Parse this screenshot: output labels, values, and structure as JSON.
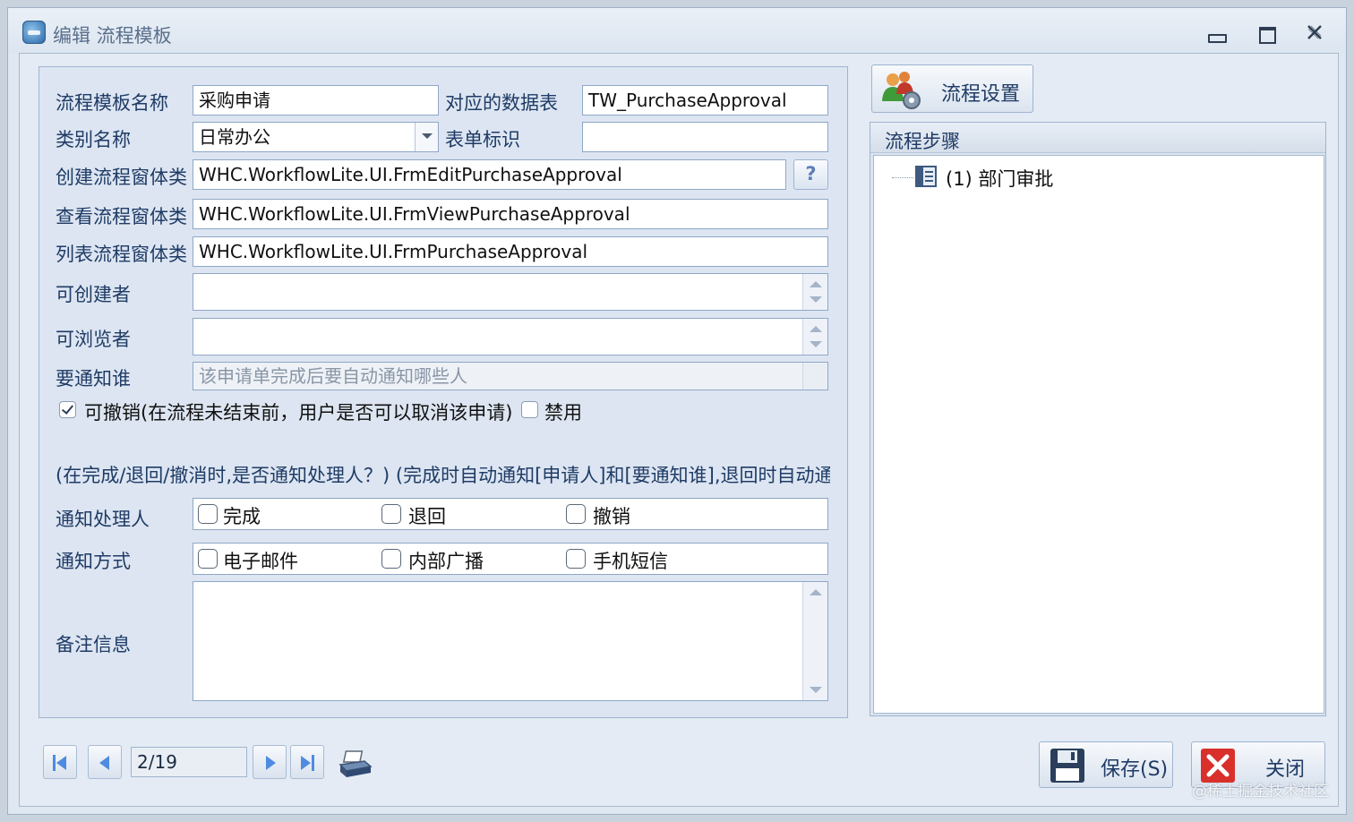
{
  "window": {
    "title": "编辑 流程模板"
  },
  "form": {
    "template_name": {
      "label": "流程模板名称",
      "value": "采购申请"
    },
    "table": {
      "label": "对应的数据表",
      "value": "TW_PurchaseApproval"
    },
    "category": {
      "label": "类别名称",
      "value": "日常办公"
    },
    "form_flag": {
      "label": "表单标识",
      "value": ""
    },
    "create_form": {
      "label": "创建流程窗体类",
      "value": "WHC.WorkflowLite.UI.FrmEditPurchaseApproval"
    },
    "help_symbol": "?",
    "view_form": {
      "label": "查看流程窗体类",
      "value": "WHC.WorkflowLite.UI.FrmViewPurchaseApproval"
    },
    "list_form": {
      "label": "列表流程窗体类",
      "value": "WHC.WorkflowLite.UI.FrmPurchaseApproval"
    },
    "creators": {
      "label": "可创建者",
      "value": ""
    },
    "viewers": {
      "label": "可浏览者",
      "value": ""
    },
    "notify_who": {
      "label": "要通知谁",
      "placeholder": "该申请单完成后要自动通知哪些人"
    },
    "revocable": {
      "label": "可撤销(在流程未结束前，用户是否可以取消该申请)",
      "checked": true
    },
    "disabled": {
      "label": "禁用",
      "checked": false
    },
    "notice_text": "(在完成/退回/撤消时,是否通知处理人？) (完成时自动通知[申请人]和[要通知谁],退回时自动通:",
    "notify_handler": {
      "label": "通知处理人",
      "options": [
        {
          "label": "完成",
          "checked": false
        },
        {
          "label": "退回",
          "checked": false
        },
        {
          "label": "撤销",
          "checked": false
        }
      ]
    },
    "notify_method": {
      "label": "通知方式",
      "options": [
        {
          "label": "电子邮件",
          "checked": false
        },
        {
          "label": "内部广播",
          "checked": false
        },
        {
          "label": "手机短信",
          "checked": false
        }
      ]
    },
    "remarks": {
      "label": "备注信息",
      "value": ""
    }
  },
  "side": {
    "settings_button": "流程设置",
    "steps_title": "流程步骤",
    "steps": [
      {
        "label": "(1) 部门审批"
      }
    ]
  },
  "pager": {
    "value": "2/19"
  },
  "actions": {
    "save": "保存(S)",
    "close": "关闭"
  },
  "watermark": "@稀土掘金技术社区",
  "colors": {
    "accent_blue": "#4f8be0",
    "label_text": "#1f3b66",
    "close_red": "#d9302c"
  }
}
